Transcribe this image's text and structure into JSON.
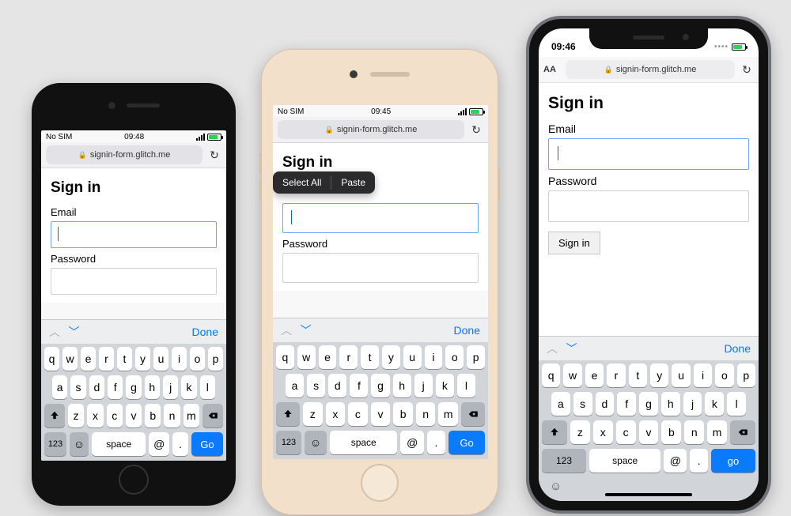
{
  "page": {
    "heading": "Sign in",
    "email_label": "Email",
    "password_label": "Password",
    "signin_button": "Sign in"
  },
  "url": "signin-form.glitch.me",
  "aa_label": "AA",
  "phones": {
    "p1": {
      "carrier": "No SIM",
      "time": "09:48"
    },
    "p2": {
      "carrier": "No SIM",
      "time": "09:45"
    },
    "p3": {
      "time": "09:46"
    }
  },
  "context_menu": {
    "select_all": "Select All",
    "paste": "Paste"
  },
  "kb_accessory": {
    "done": "Done"
  },
  "keyboard": {
    "row1": [
      "q",
      "w",
      "e",
      "r",
      "t",
      "y",
      "u",
      "i",
      "o",
      "p"
    ],
    "row2": [
      "a",
      "s",
      "d",
      "f",
      "g",
      "h",
      "j",
      "k",
      "l"
    ],
    "row3": [
      "z",
      "x",
      "c",
      "v",
      "b",
      "n",
      "m"
    ],
    "num": "123",
    "space": "space",
    "at": "@",
    "dot": ".",
    "go_upper": "Go",
    "go_lower": "go"
  }
}
